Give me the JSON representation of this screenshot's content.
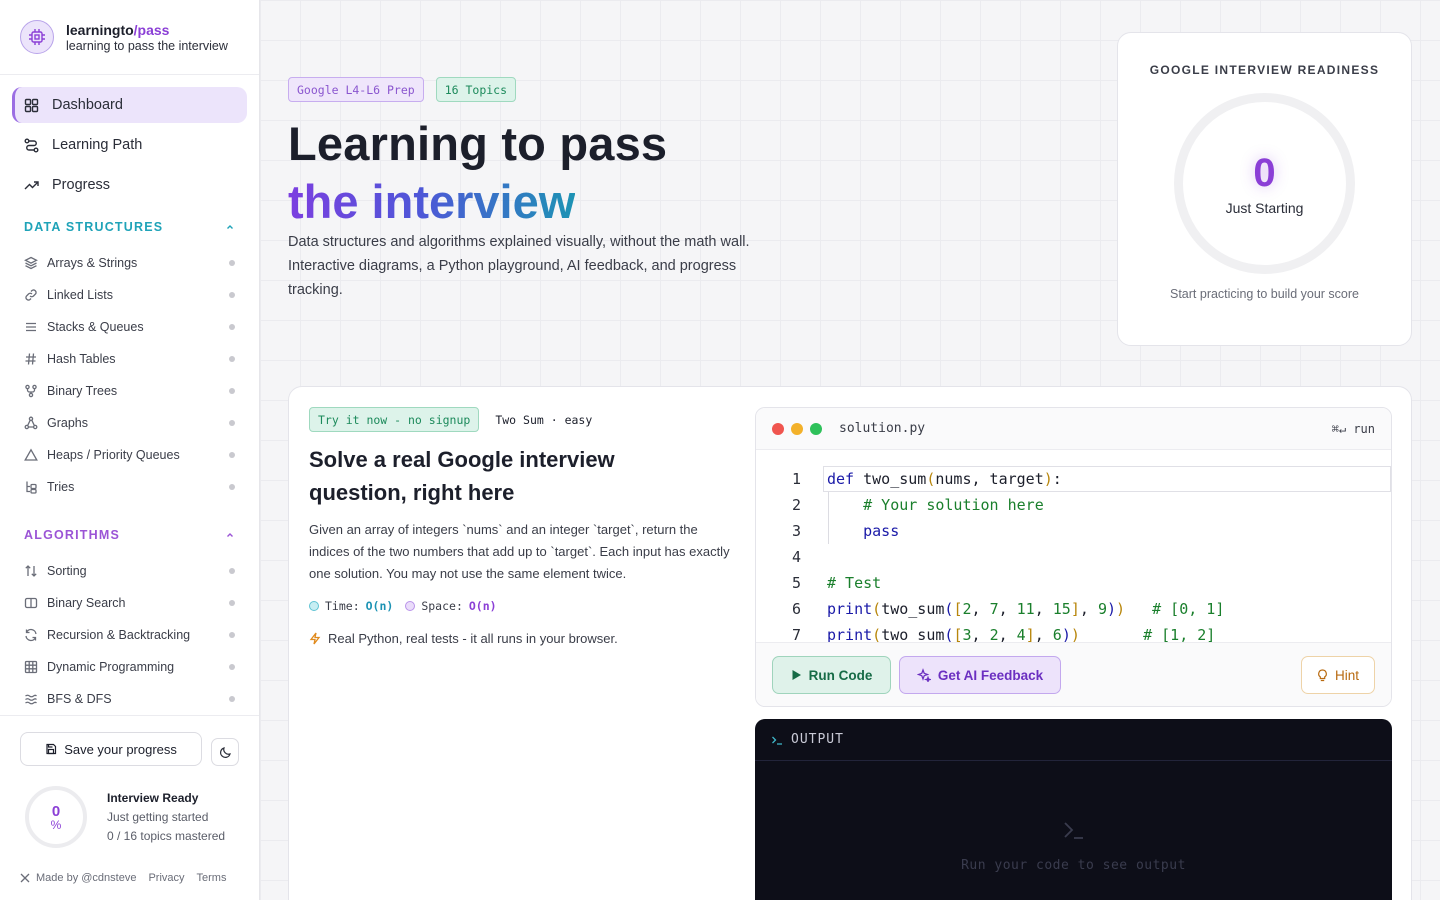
{
  "brand": {
    "name_main": "learningto",
    "name_accent": "/pass",
    "tagline": "learning to pass the interview"
  },
  "nav": [
    {
      "label": "Dashboard",
      "icon": "grid-icon",
      "active": true
    },
    {
      "label": "Learning Path",
      "icon": "route-icon",
      "active": false
    },
    {
      "label": "Progress",
      "icon": "trend-up-icon",
      "active": false
    }
  ],
  "sections": {
    "data_structures": {
      "label": "DATA STRUCTURES",
      "topics": [
        "Arrays & Strings",
        "Linked Lists",
        "Stacks & Queues",
        "Hash Tables",
        "Binary Trees",
        "Graphs",
        "Heaps / Priority Queues",
        "Tries"
      ]
    },
    "algorithms": {
      "label": "ALGORITHMS",
      "topics": [
        "Sorting",
        "Binary Search",
        "Recursion & Backtracking",
        "Dynamic Programming",
        "BFS & DFS"
      ]
    }
  },
  "sidebar_bottom": {
    "save_label": "Save your progress",
    "ready_value": "0",
    "ready_unit": "%",
    "ready_title": "Interview Ready",
    "ready_status": "Just getting started",
    "ready_count": "0 / 16 topics mastered",
    "footer": {
      "made_by": "Made by @cdnsteve",
      "privacy": "Privacy",
      "terms": "Terms"
    }
  },
  "hero": {
    "chip_prep": "Google L4-L6 Prep",
    "chip_topics": "16 Topics",
    "title_line1": "Learning to pass",
    "title_line2": "the interview",
    "lead": "Data structures and algorithms explained visually, without the math wall. Interactive diagrams, a Python playground, AI feedback, and progress tracking."
  },
  "score": {
    "title": "GOOGLE INTERVIEW READINESS",
    "value": "0",
    "label": "Just Starting",
    "sub": "Start practicing to build your score"
  },
  "challenge": {
    "chip": "Try it now - no signup",
    "meta": "Two Sum · easy",
    "title": "Solve a real Google interview question, right here",
    "description": "Given an array of integers `nums` and an integer `target`, return the indices of the two numbers that add up to `target`. Each input has exactly one solution. You may not use the same element twice.",
    "time_label": "Time:",
    "time_value": "O(n)",
    "space_label": "Space:",
    "space_value": "O(n)",
    "note": "Real Python, real tests - it all runs in your browser."
  },
  "editor": {
    "filename": "solution.py",
    "shortcut": "⌘↵ run",
    "line_numbers": [
      "1",
      "2",
      "3",
      "4",
      "5",
      "6",
      "7"
    ],
    "run_label": "Run Code",
    "ai_label": "Get AI Feedback",
    "hint_label": "Hint"
  },
  "output": {
    "title": "OUTPUT",
    "empty_message": "Run your code to see output"
  },
  "colors": {
    "accent_purple": "#8b3fd6",
    "accent_teal": "#1d93b4",
    "accent_green": "#1c8a5b"
  }
}
